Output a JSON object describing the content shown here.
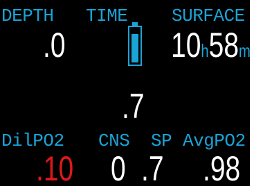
{
  "labels": {
    "depth": "DEPTH",
    "time": "TIME",
    "surface": "SURFACE",
    "dilpo2": "DilPO2",
    "cns": "CNS",
    "sp": "SP",
    "avgpo2": "AvgPO2"
  },
  "values": {
    "depth": ".0",
    "surface_hours": "10",
    "surface_hours_unit": "h",
    "surface_minutes": "58",
    "surface_minutes_unit": "m",
    "center": ".7",
    "dilpo2": ".10",
    "cns": "0",
    "sp": ".7",
    "avgpo2": ".98"
  },
  "battery": {
    "level": 0.85
  },
  "colors": {
    "label": "#1aa3d6",
    "value": "#ffffff",
    "warning": "#e01818",
    "background": "#000000"
  }
}
